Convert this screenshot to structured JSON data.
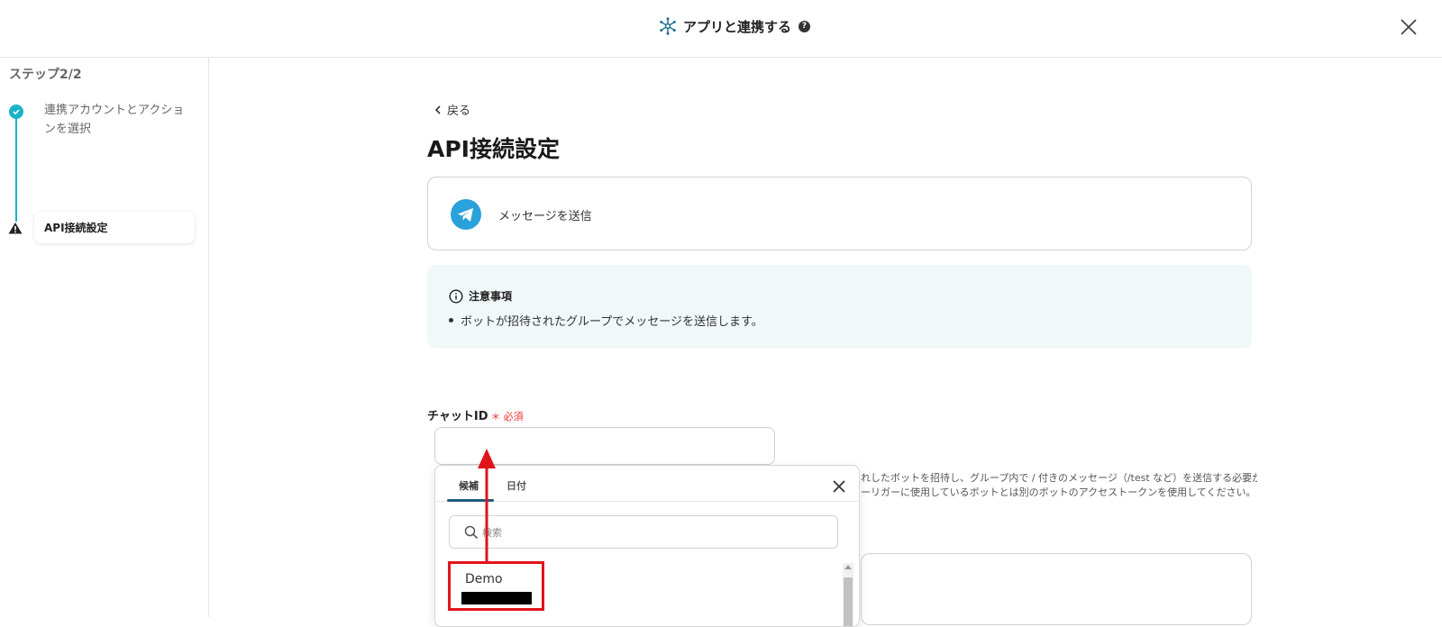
{
  "header": {
    "title": "アプリと連携する",
    "help_icon": "question-circle-icon"
  },
  "sidebar": {
    "step_title": "ステップ2/2",
    "steps": [
      {
        "label": "連携アカウントとアクションを選択",
        "status": "complete"
      },
      {
        "label": "API接続設定",
        "status": "warning"
      }
    ]
  },
  "main": {
    "back_label": "戻る",
    "page_title": "API接続設定",
    "action": {
      "label": "メッセージを送信",
      "icon": "telegram-icon"
    },
    "notice": {
      "heading": "注意事項",
      "items": [
        "ボットが招待されたグループでメッセージを送信します。"
      ]
    },
    "field": {
      "label": "チャットID",
      "required_mark": "＊",
      "required_text": "必須",
      "value": ""
    },
    "helper_text_line1": "れしたボットを招待し、グループ内で / 付きのメッセージ（/test など）を送信する必要が",
    "helper_text_line2": "ーリガーに使用しているボットとは別のボットのアクセストークンを使用してください。"
  },
  "dropdown": {
    "tabs": [
      {
        "label": "候補",
        "active": true
      },
      {
        "label": "日付",
        "active": false
      }
    ],
    "search_placeholder": "検索",
    "options": [
      {
        "name": "Demo"
      }
    ]
  },
  "colors": {
    "accent": "#1ab3c6",
    "highlight": "#e0141a",
    "notice_bg": "#f1f8f8"
  }
}
